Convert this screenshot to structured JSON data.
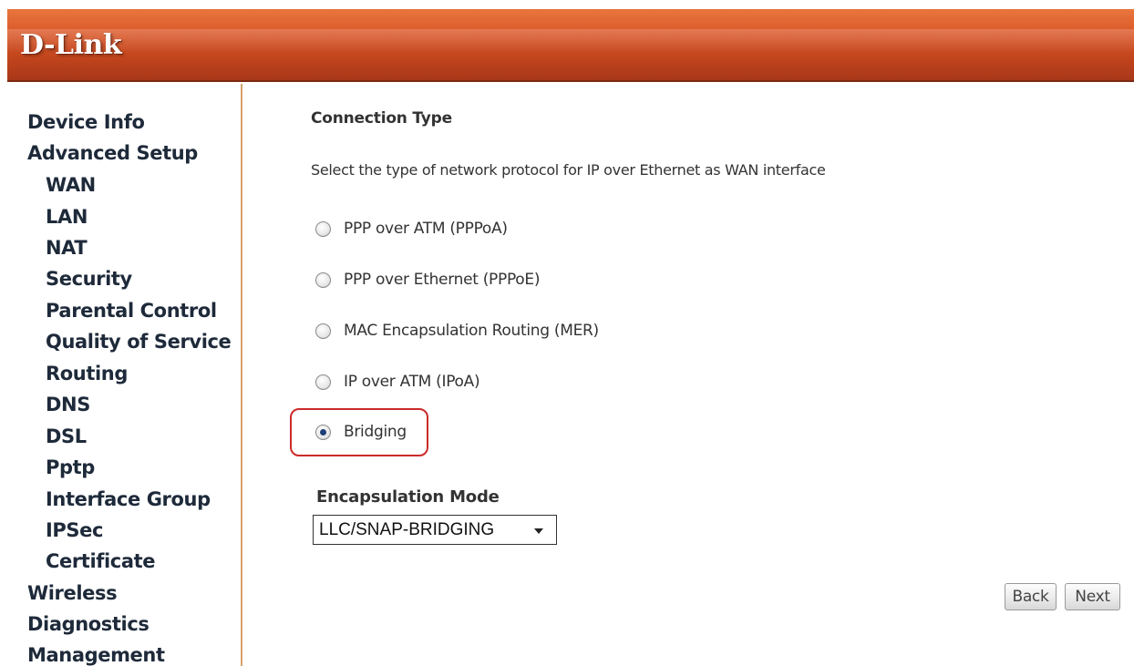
{
  "header": {
    "logo_text": "D-Link"
  },
  "sidebar": {
    "items": [
      {
        "label": "Device Info",
        "level": "top"
      },
      {
        "label": "Advanced Setup",
        "level": "top"
      },
      {
        "label": "WAN",
        "level": "sub"
      },
      {
        "label": "LAN",
        "level": "sub"
      },
      {
        "label": "NAT",
        "level": "sub"
      },
      {
        "label": "Security",
        "level": "sub"
      },
      {
        "label": "Parental Control",
        "level": "sub"
      },
      {
        "label": "Quality of Service",
        "level": "sub"
      },
      {
        "label": "Routing",
        "level": "sub"
      },
      {
        "label": "DNS",
        "level": "sub"
      },
      {
        "label": "DSL",
        "level": "sub"
      },
      {
        "label": "Pptp",
        "level": "sub"
      },
      {
        "label": "Interface Group",
        "level": "sub"
      },
      {
        "label": "IPSec",
        "level": "sub"
      },
      {
        "label": "Certificate",
        "level": "sub"
      },
      {
        "label": "Wireless",
        "level": "top"
      },
      {
        "label": "Diagnostics",
        "level": "top"
      },
      {
        "label": "Management",
        "level": "top"
      }
    ]
  },
  "main": {
    "section_title": "Connection Type",
    "description": "Select the type of network protocol for IP over Ethernet as WAN interface",
    "options": [
      {
        "label": "PPP over ATM (PPPoA)",
        "selected": false
      },
      {
        "label": "PPP over Ethernet (PPPoE)",
        "selected": false
      },
      {
        "label": "MAC Encapsulation Routing (MER)",
        "selected": false
      },
      {
        "label": "IP over ATM (IPoA)",
        "selected": false
      },
      {
        "label": "Bridging",
        "selected": true
      }
    ],
    "encapsulation": {
      "label": "Encapsulation Mode",
      "selected_value": "LLC/SNAP-BRIDGING"
    },
    "buttons": {
      "back": "Back",
      "next": "Next"
    }
  },
  "colors": {
    "header_orange": "#d9582a",
    "sidebar_border": "#d9a26b",
    "highlight_red": "#cc2a2a"
  }
}
